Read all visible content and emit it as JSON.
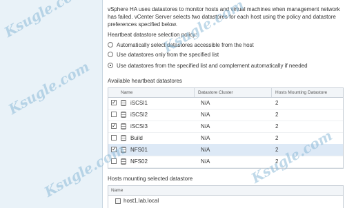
{
  "description": "vSphere HA uses datastores to monitor hosts and virtual machines when management network has failed. vCenter Server selects two datastores for each host using the policy and datastore preferences specified below.",
  "policy": {
    "label": "Heartbeat datastore selection policy:",
    "options": [
      {
        "label": "Automatically select datastores accessible from the host",
        "selected": false
      },
      {
        "label": "Use datastores only from the specified list",
        "selected": false
      },
      {
        "label": "Use datastores from the specified list and complement automatically if needed",
        "selected": true
      }
    ]
  },
  "available": {
    "label": "Available heartbeat datastores",
    "columns": [
      "Name",
      "Datastore Cluster",
      "Hosts Mounting Datastore"
    ],
    "rows": [
      {
        "name": "iSCSI1",
        "cluster": "N/A",
        "hosts": "2",
        "checked": true,
        "selected": false
      },
      {
        "name": "iSCSI2",
        "cluster": "N/A",
        "hosts": "2",
        "checked": false,
        "selected": false
      },
      {
        "name": "iSCSI3",
        "cluster": "N/A",
        "hosts": "2",
        "checked": true,
        "selected": false
      },
      {
        "name": "Build",
        "cluster": "N/A",
        "hosts": "2",
        "checked": false,
        "selected": false
      },
      {
        "name": "NFS01",
        "cluster": "N/A",
        "hosts": "2",
        "checked": true,
        "selected": true
      },
      {
        "name": "NFS02",
        "cluster": "N/A",
        "hosts": "2",
        "checked": false,
        "selected": false
      }
    ]
  },
  "hosts": {
    "label": "Hosts mounting selected datastore",
    "column": "Name",
    "rows": [
      "host1.lab.local"
    ]
  },
  "watermark": "Ksugle.com",
  "colors": {
    "left_pane": "#e9f2f8",
    "selected_row": "#dde9f6",
    "watermark": "#8cb9d7"
  }
}
